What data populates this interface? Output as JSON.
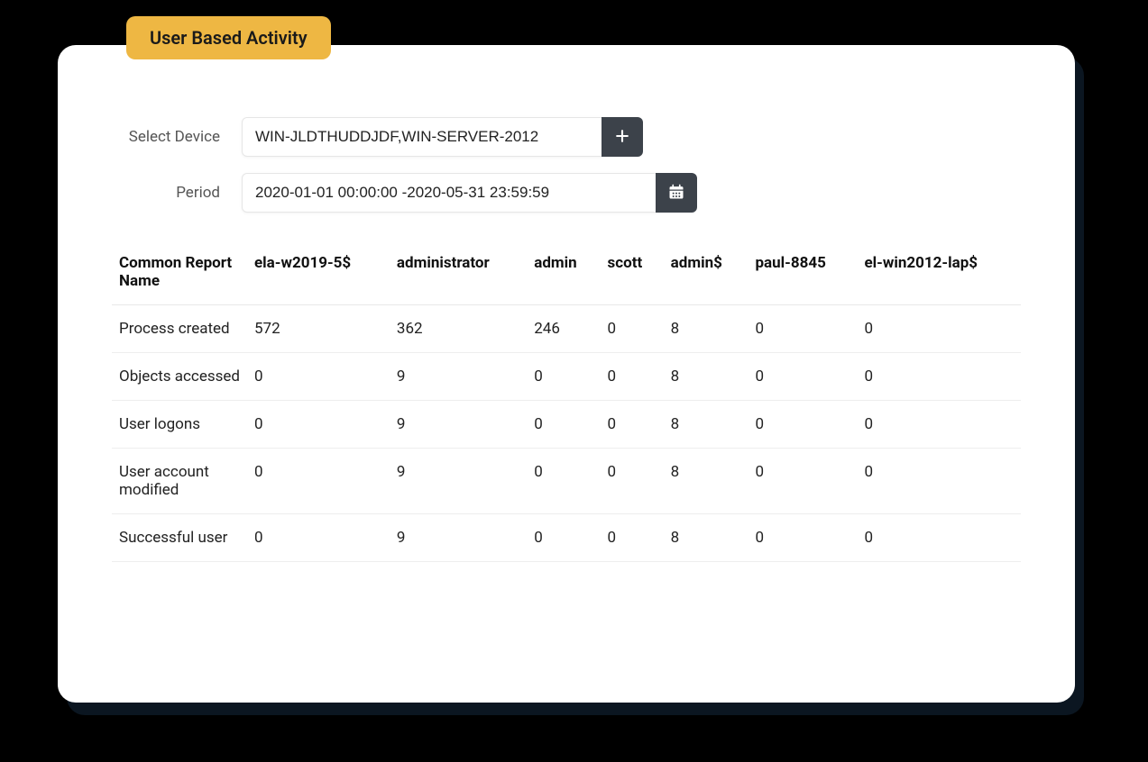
{
  "tab": {
    "label": "User Based Activity"
  },
  "filters": {
    "device_label": "Select Device",
    "device_value": "WIN-JLDTHUDDJDF,WIN-SERVER-2012",
    "period_label": "Period",
    "period_value": "2020-01-01 00:00:00 -2020-05-31 23:59:59"
  },
  "table": {
    "headers": [
      "Common Report Name",
      "ela-w2019-5$",
      "administrator",
      "admin",
      "scott",
      "admin$",
      "paul-8845",
      "el-win2012-lap$"
    ],
    "rows": [
      {
        "name": "Process created",
        "values": [
          "572",
          "362",
          "246",
          "0",
          "8",
          "0",
          "0"
        ]
      },
      {
        "name": "Objects accessed",
        "values": [
          "0",
          "9",
          "0",
          "0",
          "8",
          "0",
          "0"
        ]
      },
      {
        "name": "User logons",
        "values": [
          "0",
          "9",
          "0",
          "0",
          "8",
          "0",
          "0"
        ]
      },
      {
        "name": "User account modified",
        "values": [
          "0",
          "9",
          "0",
          "0",
          "8",
          "0",
          "0"
        ]
      },
      {
        "name": "Successful user",
        "values": [
          "0",
          "9",
          "0",
          "0",
          "8",
          "0",
          "0"
        ]
      }
    ]
  }
}
